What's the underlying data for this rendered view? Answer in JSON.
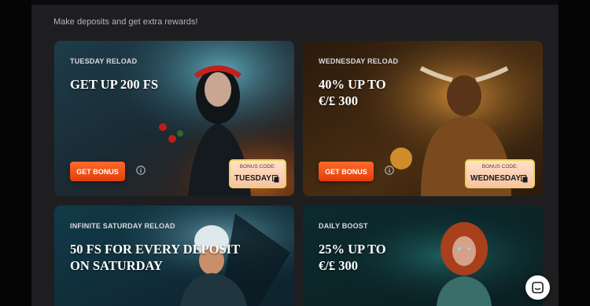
{
  "promo": {
    "subtitle": "Make deposits and get extra rewards!"
  },
  "cards": [
    {
      "label": "TUESDAY RELOAD",
      "headline": [
        "GET UP 200 FS"
      ],
      "button": "GET BONUS",
      "code_label": "BONUS CODE:",
      "code": "TUESDAY"
    },
    {
      "label": "WEDNESDAY RELOAD",
      "headline": [
        "40% UP TO",
        "€/£ 300"
      ],
      "button": "GET BONUS",
      "code_label": "BONUS CODE:",
      "code": "WEDNESDAY"
    },
    {
      "label": "INFINITE SATURDAY RELOAD",
      "headline": [
        "50 FS FOR EVERY DEPOSIT",
        "ON SATURDAY"
      ]
    },
    {
      "label": "DAILY BOOST",
      "headline": [
        "25% UP TO",
        "€/£ 300"
      ]
    }
  ],
  "colors": {
    "button": "#e8461a",
    "panel": "#1e1e21",
    "code_border": "#e8d45a"
  },
  "icons": [
    "info-icon",
    "copy-icon",
    "chat-icon"
  ]
}
